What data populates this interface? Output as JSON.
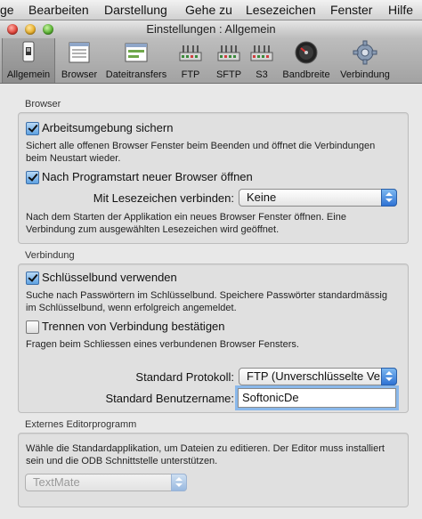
{
  "menubar": {
    "items": [
      "ge",
      "Bearbeiten",
      "Darstellung",
      "Gehe zu",
      "Lesezeichen",
      "Fenster",
      "Hilfe"
    ]
  },
  "window": {
    "title": "Einstellungen : Allgemein"
  },
  "toolbar": {
    "items": [
      {
        "label": "Allgemein",
        "icon": "switch-icon",
        "selected": true
      },
      {
        "label": "Browser",
        "icon": "browser-window-icon"
      },
      {
        "label": "Dateitransfers",
        "icon": "file-transfer-icon"
      },
      {
        "label": "FTP",
        "icon": "ftp-network-icon"
      },
      {
        "label": "SFTP",
        "icon": "sftp-network-icon"
      },
      {
        "label": "S3",
        "icon": "s3-network-icon"
      },
      {
        "label": "Bandbreite",
        "icon": "bandwidth-gauge-icon"
      },
      {
        "label": "Verbindung",
        "icon": "gear-icon"
      }
    ]
  },
  "browser_group": {
    "title": "Browser",
    "save_workspace": {
      "label": "Arbeitsumgebung sichern",
      "checked": true,
      "description": "Sichert alle offenen Browser Fenster beim Beenden und öffnet die Verbindungen beim Neustart wieder."
    },
    "new_browser": {
      "label": "Nach Programstart neuer Browser öffnen",
      "checked": true
    },
    "bookmark_connect": {
      "label": "Mit Lesezeichen verbinden:",
      "value": "Keine"
    },
    "new_browser_description": "Nach dem Starten der Applikation ein neues Browser Fenster öffnen. Eine Verbindung zum ausgewählten Lesezeichen wird geöffnet."
  },
  "connection_group": {
    "title": "Verbindung",
    "keychain": {
      "label": "Schlüsselbund verwenden",
      "checked": true,
      "description": "Suche nach Passwörtern im Schlüsselbund. Speichere Passwörter standardmässig im Schlüsselbund, wenn erfolgreich angemeldet."
    },
    "confirm_disconnect": {
      "label": "Trennen von Verbindung bestätigen",
      "checked": false,
      "description": "Fragen beim Schliessen eines verbundenen Browser Fensters."
    },
    "protocol": {
      "label": "Standard Protokoll:",
      "value": "FTP (Unverschlüsselte Ver"
    },
    "username": {
      "label": "Standard Benutzername:",
      "value": "SoftonicDe"
    }
  },
  "editor_group": {
    "title": "Externes Editorprogramm",
    "description": "Wähle die Standardapplikation, um Dateien zu editieren. Der Editor muss installiert sein und die ODB Schnittstelle unterstützen.",
    "editor": {
      "value": "TextMate"
    }
  },
  "colors": {
    "accent": "#3b7fd9",
    "toolbar_bg": "#a8a8a8",
    "window_bg": "#e8e8e8"
  }
}
